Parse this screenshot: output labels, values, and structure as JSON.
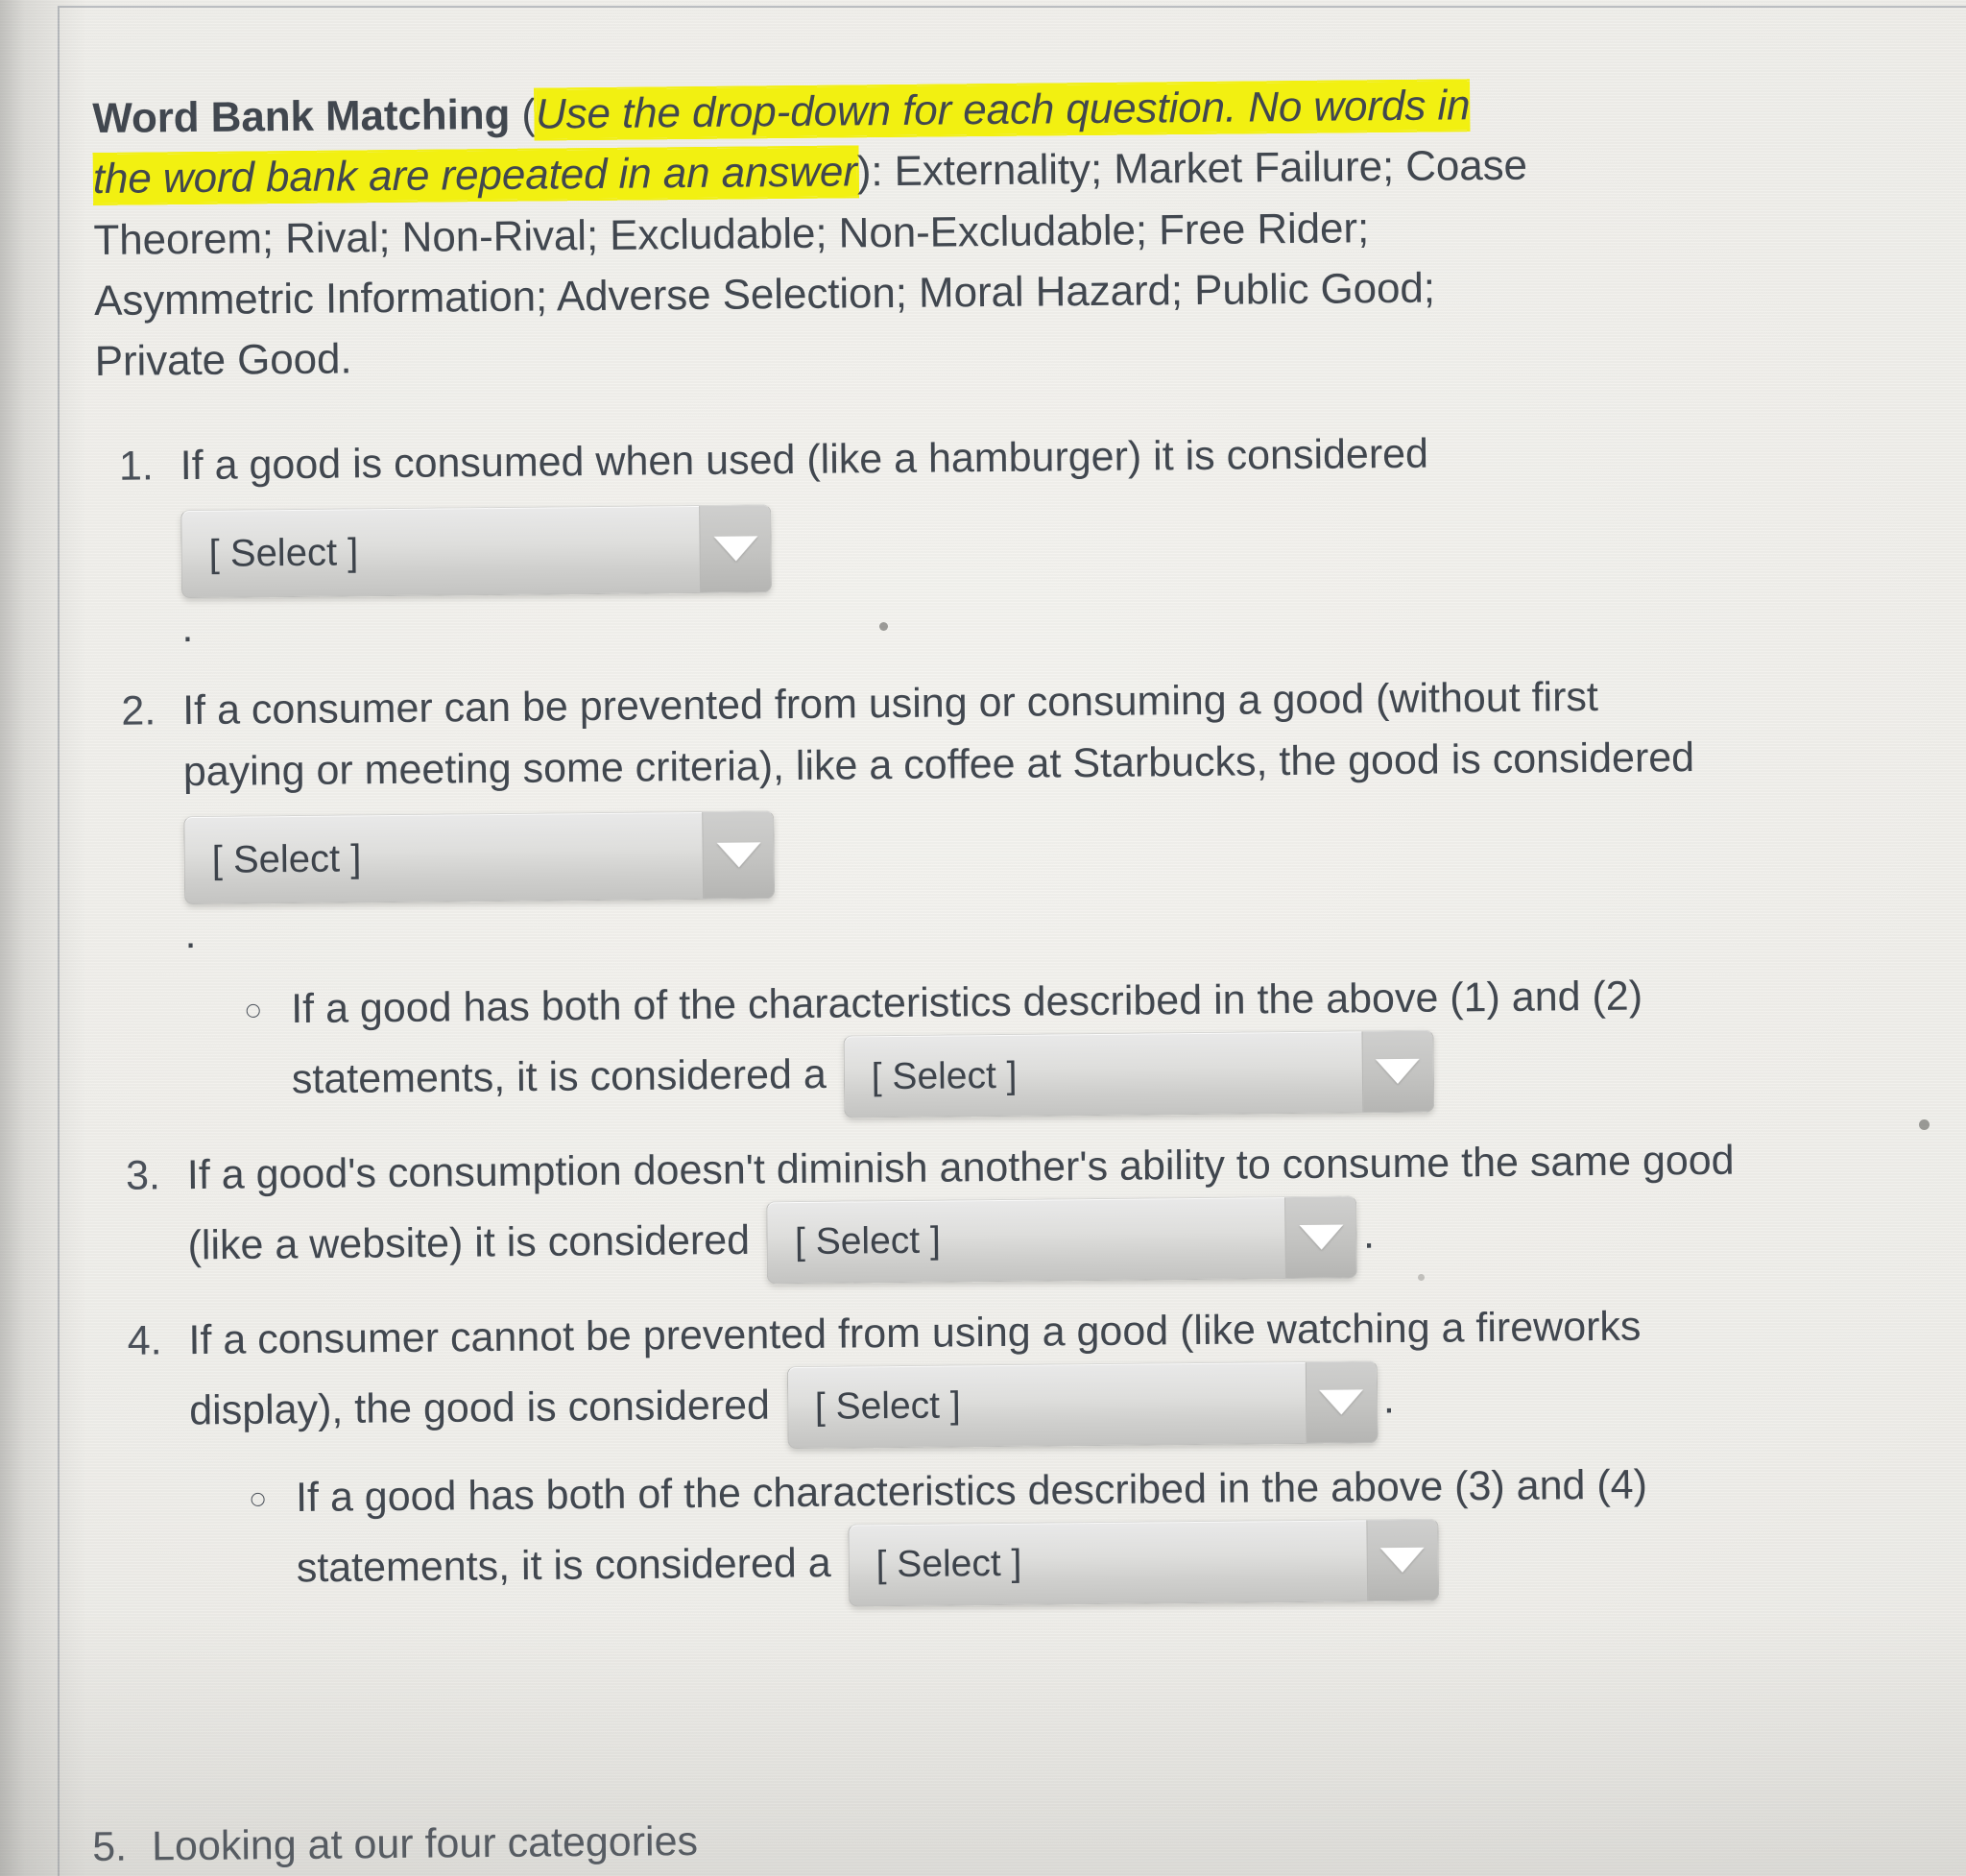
{
  "document": {
    "heading_bold": "Word Bank Matching",
    "paren_open": " (",
    "highlight_italic": "Use the drop-down for each question. No words in the word bank are repeated in an answer",
    "paren_close": "): ",
    "word_bank": "Externality; Market Failure; Coase Theorem; Rival; Non-Rival; Excludable; Non-Excludable; Free Rider; Asymmetric Information; Adverse Selection; Moral Hazard; Public Good; Private Good.",
    "highlight_color": "#f2f011",
    "text_color": "#41474f"
  },
  "select": {
    "placeholder": "[ Select ]",
    "arrow_icon": "chevron-down-icon"
  },
  "questions": [
    {
      "number": "1.",
      "text_before": "If a good is consumed when used (like a hamburger) it is considered",
      "select_value": "[ Select ]",
      "text_after": ".",
      "select_position": "block"
    },
    {
      "number": "2.",
      "text_before": "If a consumer can be prevented from using or consuming a good (without first paying or meeting some criteria), like a coffee at Starbucks, the good is considered",
      "select_value": "[ Select ]",
      "text_after": ".",
      "select_position": "block",
      "sub_bullet": {
        "marker": "circle",
        "text_before": "If a good has both of the characteristics described in the above (1) and (2) statements, it is considered a",
        "select_value": "[ Select ]",
        "text_after": ""
      }
    },
    {
      "number": "3.",
      "text_before": "If a good's consumption doesn't diminish another's ability to consume the same good (like a website) it is considered",
      "select_value": "[ Select ]",
      "text_after": ".",
      "select_position": "inline"
    },
    {
      "number": "4.",
      "text_before": "If a consumer cannot be prevented from using a good (like watching a fireworks display), the good is considered",
      "select_value": "[ Select ]",
      "text_after": ".",
      "select_position": "inline",
      "sub_bullet": {
        "marker": "circle",
        "text_before": "If a good has both of the characteristics described in the above (3) and (4) statements, it is considered a",
        "select_value": "[ Select ]",
        "text_after": ""
      }
    }
  ],
  "clipped_item": {
    "number": "5.",
    "text": "Looking at our four categories"
  }
}
